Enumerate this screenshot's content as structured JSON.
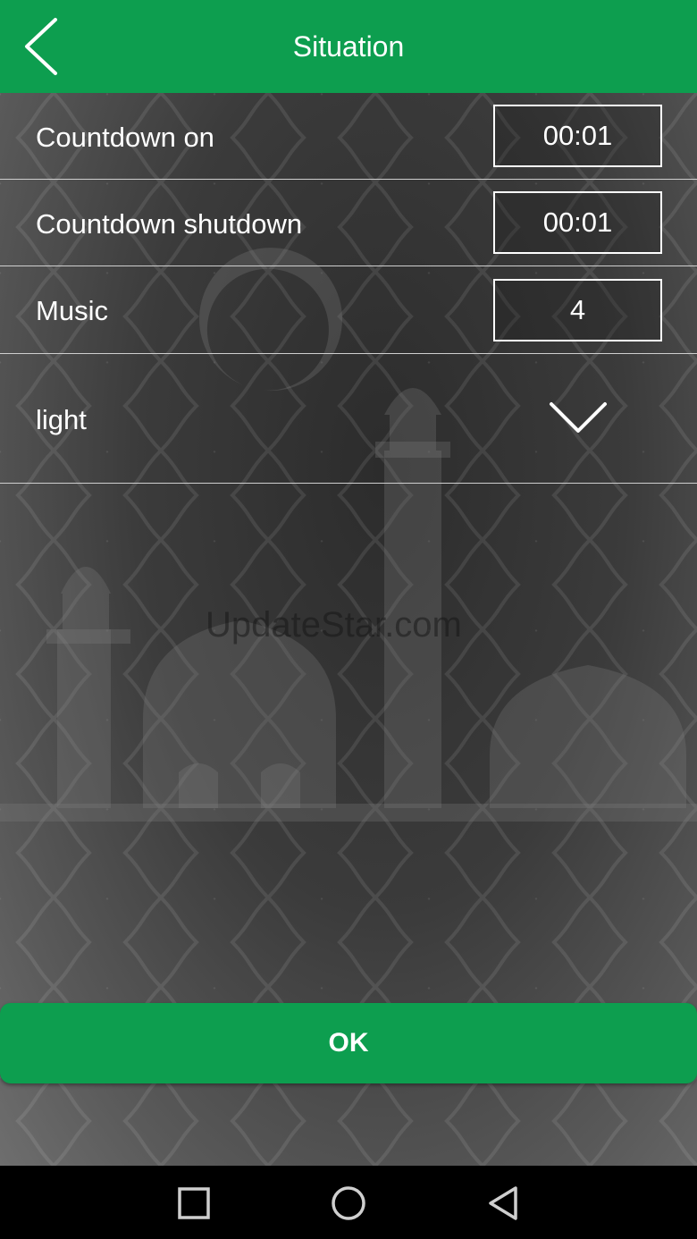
{
  "header": {
    "title": "Situation",
    "back_icon": "chevron-left-icon"
  },
  "rows": [
    {
      "label": "Countdown on",
      "value": "00:01"
    },
    {
      "label": "Countdown shutdown",
      "value": "00:01"
    },
    {
      "label": "Music",
      "value": "4"
    }
  ],
  "light": {
    "label": "light",
    "icon": "chevron-down-icon"
  },
  "watermark": "UpdateStar.com",
  "ok_label": "OK",
  "navbar": {
    "recent": "square-icon",
    "home": "circle-icon",
    "back": "triangle-back-icon"
  },
  "colors": {
    "accent": "#0d9e4f",
    "text": "#ffffff"
  }
}
